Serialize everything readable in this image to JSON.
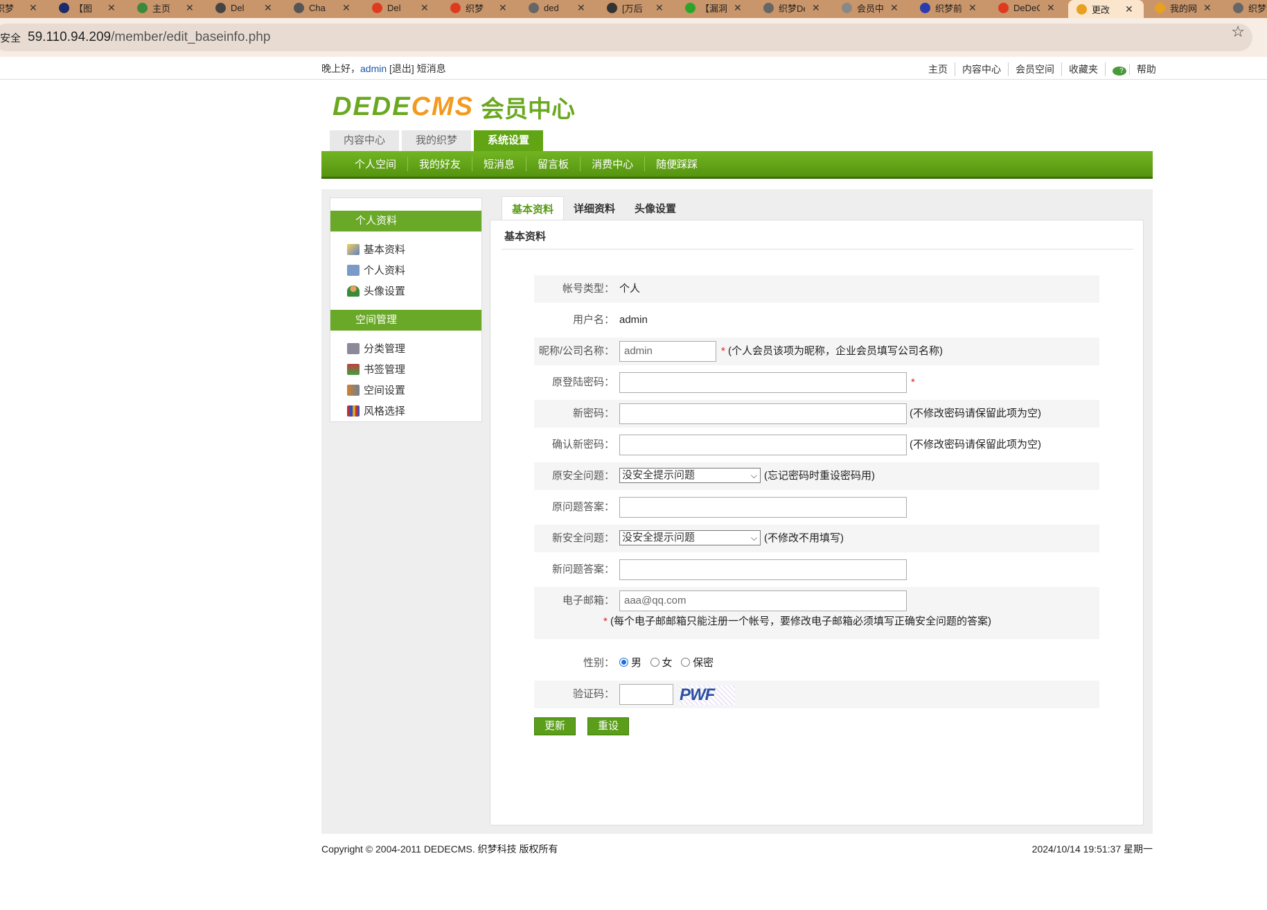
{
  "browser": {
    "tabs": [
      {
        "title": "织梦",
        "color": "#555"
      },
      {
        "title": "【图",
        "color": "#1a2a6a"
      },
      {
        "title": "主页",
        "color": "#3b8a3b"
      },
      {
        "title": "Del",
        "color": "#444"
      },
      {
        "title": "Cha",
        "color": "#555"
      },
      {
        "title": "Del",
        "color": "#e03a1e"
      },
      {
        "title": "织梦",
        "color": "#e03a1e"
      },
      {
        "title": "ded",
        "color": "#666"
      },
      {
        "title": "[万后",
        "color": "#333"
      },
      {
        "title": "【漏洞",
        "color": "#2aa52a"
      },
      {
        "title": "织梦De",
        "color": "#666"
      },
      {
        "title": "会员中心",
        "color": "#888"
      },
      {
        "title": "织梦前台",
        "color": "#2a3ab0"
      },
      {
        "title": "DeDeC",
        "color": "#e03a1e"
      },
      {
        "title": "更改",
        "color": "#e8a020"
      },
      {
        "title": "我的网站",
        "color": "#e8a020"
      },
      {
        "title": "织梦",
        "color": "#666"
      }
    ],
    "secure_label": "安全",
    "url_host": "59.110.94.209",
    "url_path": "/member/edit_baseinfo.php"
  },
  "topbar": {
    "greeting": "晚上好，",
    "username": "admin",
    "logout": "[退出]",
    "messages": "短消息",
    "links": [
      "主页",
      "内容中心",
      "会员空间",
      "收藏夹",
      "帮助"
    ]
  },
  "logo": {
    "part1": "DEDE",
    "part2": "CMS",
    "part3": "会员中心"
  },
  "main_tabs": [
    "内容中心",
    "我的织梦",
    "系统设置"
  ],
  "sub_nav": [
    "个人空间",
    "我的好友",
    "短消息",
    "留言板",
    "消费中心",
    "随便踩踩"
  ],
  "sidebar": {
    "section1": "个人资料",
    "items1": [
      "基本资料",
      "个人资料",
      "头像设置"
    ],
    "section2": "空间管理",
    "items2": [
      "分类管理",
      "书签管理",
      "空间设置",
      "风格选择"
    ]
  },
  "content_tabs": [
    "基本资料",
    "详细资料",
    "头像设置"
  ],
  "section_title": "基本资料",
  "form": {
    "account_type_label": "帐号类型：",
    "account_type": "个人",
    "username_label": "用户名：",
    "username": "admin",
    "nickname_label": "昵称/公司名称：",
    "nickname": "admin",
    "nickname_note": "(个人会员该项为昵称，企业会员填写公司名称)",
    "old_password_label": "原登陆密码：",
    "new_password_label": "新密码：",
    "new_password_note": "(不修改密码请保留此项为空)",
    "confirm_password_label": "确认新密码：",
    "confirm_password_note": "(不修改密码请保留此项为空)",
    "old_question_label": "原安全问题：",
    "old_question": "没安全提示问题",
    "old_question_note": "(忘记密码时重设密码用)",
    "old_answer_label": "原问题答案：",
    "new_question_label": "新安全问题：",
    "new_question": "没安全提示问题",
    "new_question_note": "(不修改不用填写)",
    "new_answer_label": "新问题答案：",
    "email_label": "电子邮箱：",
    "email": "aaa@qq.com",
    "email_note": "(每个电子邮邮箱只能注册一个帐号，要修改电子邮箱必须填写正确安全问题的答案)",
    "gender_label": "性别：",
    "gender_options": [
      "男",
      "女",
      "保密"
    ],
    "captcha_label": "验证码：",
    "captcha_text": "PWF",
    "submit": "更新",
    "reset": "重设"
  },
  "footer": {
    "copyright": "Copyright © 2004-2011 DEDECMS. 织梦科技 版权所有",
    "datetime": "2024/10/14 19:51:37 星期一"
  }
}
